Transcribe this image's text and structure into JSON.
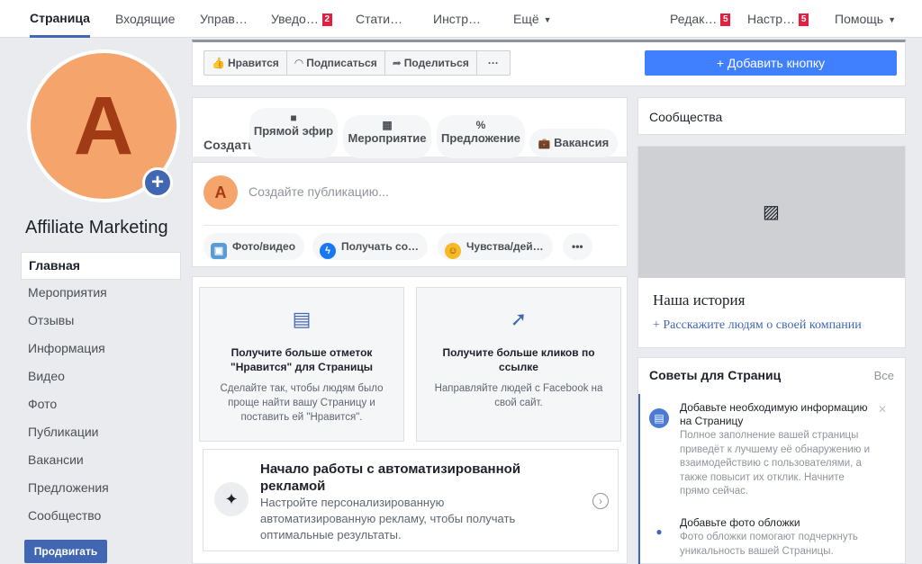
{
  "topnav": {
    "tabs": [
      {
        "label": "Страница"
      },
      {
        "label": "Входящие"
      },
      {
        "label": "Управ…"
      },
      {
        "label": "Уведо…",
        "badge": "2"
      },
      {
        "label": "Стати…"
      },
      {
        "label": "Инстр…"
      },
      {
        "label": "Ещё"
      },
      {
        "label": "Редак…",
        "badge": "5"
      },
      {
        "label": "Настр…",
        "badge": "5"
      },
      {
        "label": "Помощь"
      }
    ]
  },
  "page": {
    "avatar_letter": "A",
    "name": "Affiliate Marketing"
  },
  "leftnav": {
    "items": [
      {
        "label": "Главная"
      },
      {
        "label": "Мероприятия"
      },
      {
        "label": "Отзывы"
      },
      {
        "label": "Информация"
      },
      {
        "label": "Видео"
      },
      {
        "label": "Фото"
      },
      {
        "label": "Публикации"
      },
      {
        "label": "Вакансии"
      },
      {
        "label": "Предложения"
      },
      {
        "label": "Сообщество"
      }
    ],
    "promote_label": "Продвигать"
  },
  "actionbar": {
    "like": "Нравится",
    "follow": "Подписаться",
    "share": "Поделиться",
    "more": "···",
    "add_button": "+ Добавить кнопку"
  },
  "create": {
    "label": "Создать",
    "live": "Прямой эфир",
    "event": "Мероприятие",
    "offer": "Предложение",
    "job": "Вакансия"
  },
  "composer": {
    "avatar_letter": "A",
    "placeholder": "Создайте публикацию...",
    "photo": "Фото/видео",
    "messages": "Получать со…",
    "feeling": "Чувства/дей…",
    "more": "•••"
  },
  "promo": {
    "card1": {
      "title": "Получите больше отметок \"Нравится\" для Страницы",
      "desc": "Сделайте так, чтобы людям было проще найти вашу Страницу и поставить ей \"Нравится\"."
    },
    "card2": {
      "title": "Получите больше кликов по ссылке",
      "desc": "Направляйте людей с Facebook на свой сайт."
    },
    "auto": {
      "title": "Начало работы с автоматизированной рекламой",
      "desc": "Настройте персонализированную автоматизированную рекламу, чтобы получать оптимальные результаты."
    }
  },
  "right": {
    "communities": "Сообщества",
    "story_title": "Наша история",
    "story_link": "+ Расскажите людям о своей компании",
    "tips_head": "Советы для Страниц",
    "tips_all": "Все",
    "tip1_title": "Добавьте необходимую информацию на Страницу",
    "tip1_desc": "Полное заполнение вашей страницы приведёт к лучшему её обнаружению и взаимодействию с пользователями, а также повысит их отклик. Начните прямо сейчас.",
    "tip2_title": "Добавьте фото обложки",
    "tip2_desc": "Фото обложки помогают подчеркнуть уникальность вашей Страницы."
  },
  "colors": {
    "accent": "#4267b2",
    "button_blue": "#4080ff",
    "avatar_bg": "#f5a46b",
    "avatar_letter": "#a13b15",
    "badge": "#e41e3f"
  }
}
